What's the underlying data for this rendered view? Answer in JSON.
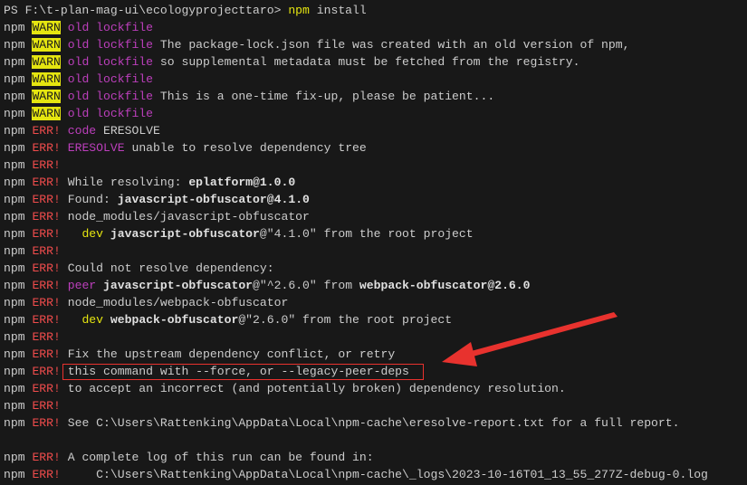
{
  "terminal": {
    "lines": [
      [
        [
          "t",
          "PS F:\\t-plan-mag-ui\\ecologyprojecttaro> "
        ],
        [
          "y",
          "npm"
        ],
        [
          "t",
          " install"
        ]
      ],
      [
        [
          "t",
          "npm "
        ],
        [
          "w",
          "WARN"
        ],
        [
          "t",
          " "
        ],
        [
          "m",
          "old lockfile"
        ]
      ],
      [
        [
          "t",
          "npm "
        ],
        [
          "w",
          "WARN"
        ],
        [
          "t",
          " "
        ],
        [
          "m",
          "old lockfile"
        ],
        [
          "t",
          " The package-lock.json file was created with an old version of npm,"
        ]
      ],
      [
        [
          "t",
          "npm "
        ],
        [
          "w",
          "WARN"
        ],
        [
          "t",
          " "
        ],
        [
          "m",
          "old lockfile"
        ],
        [
          "t",
          " so supplemental metadata must be fetched from the registry."
        ]
      ],
      [
        [
          "t",
          "npm "
        ],
        [
          "w",
          "WARN"
        ],
        [
          "t",
          " "
        ],
        [
          "m",
          "old lockfile"
        ]
      ],
      [
        [
          "t",
          "npm "
        ],
        [
          "w",
          "WARN"
        ],
        [
          "t",
          " "
        ],
        [
          "m",
          "old lockfile"
        ],
        [
          "t",
          " This is a one-time fix-up, please be patient..."
        ]
      ],
      [
        [
          "t",
          "npm "
        ],
        [
          "w",
          "WARN"
        ],
        [
          "t",
          " "
        ],
        [
          "m",
          "old lockfile"
        ]
      ],
      [
        [
          "t",
          "npm "
        ],
        [
          "r",
          "ERR!"
        ],
        [
          "t",
          " "
        ],
        [
          "m",
          "code"
        ],
        [
          "t",
          " ERESOLVE"
        ]
      ],
      [
        [
          "t",
          "npm "
        ],
        [
          "r",
          "ERR!"
        ],
        [
          "t",
          " "
        ],
        [
          "m",
          "ERESOLVE"
        ],
        [
          "t",
          " unable to resolve dependency tree"
        ]
      ],
      [
        [
          "t",
          "npm "
        ],
        [
          "r",
          "ERR!"
        ]
      ],
      [
        [
          "t",
          "npm "
        ],
        [
          "r",
          "ERR!"
        ],
        [
          "t",
          " While resolving: "
        ],
        [
          "b",
          "eplatform@1.0.0"
        ]
      ],
      [
        [
          "t",
          "npm "
        ],
        [
          "r",
          "ERR!"
        ],
        [
          "t",
          " Found: "
        ],
        [
          "b",
          "javascript-obfuscator@4.1.0"
        ]
      ],
      [
        [
          "t",
          "npm "
        ],
        [
          "r",
          "ERR!"
        ],
        [
          "t",
          " node_modules/javascript-obfuscator"
        ]
      ],
      [
        [
          "t",
          "npm "
        ],
        [
          "r",
          "ERR!"
        ],
        [
          "t",
          "   "
        ],
        [
          "y",
          "dev"
        ],
        [
          "t",
          " "
        ],
        [
          "b",
          "javascript-obfuscator"
        ],
        [
          "t",
          "@\"4.1.0\" from the root project"
        ]
      ],
      [
        [
          "t",
          "npm "
        ],
        [
          "r",
          "ERR!"
        ]
      ],
      [
        [
          "t",
          "npm "
        ],
        [
          "r",
          "ERR!"
        ],
        [
          "t",
          " Could not resolve dependency:"
        ]
      ],
      [
        [
          "t",
          "npm "
        ],
        [
          "r",
          "ERR!"
        ],
        [
          "t",
          " "
        ],
        [
          "m",
          "peer"
        ],
        [
          "t",
          " "
        ],
        [
          "b",
          "javascript-obfuscator"
        ],
        [
          "t",
          "@\"^2.6.0\" from "
        ],
        [
          "b",
          "webpack-obfuscator@2.6.0"
        ]
      ],
      [
        [
          "t",
          "npm "
        ],
        [
          "r",
          "ERR!"
        ],
        [
          "t",
          " node_modules/webpack-obfuscator"
        ]
      ],
      [
        [
          "t",
          "npm "
        ],
        [
          "r",
          "ERR!"
        ],
        [
          "t",
          "   "
        ],
        [
          "y",
          "dev"
        ],
        [
          "t",
          " "
        ],
        [
          "b",
          "webpack-obfuscator"
        ],
        [
          "t",
          "@\"2.6.0\" from the root project"
        ]
      ],
      [
        [
          "t",
          "npm "
        ],
        [
          "r",
          "ERR!"
        ]
      ],
      [
        [
          "t",
          "npm "
        ],
        [
          "r",
          "ERR!"
        ],
        [
          "t",
          " Fix the upstream dependency conflict, or retry"
        ]
      ],
      [
        [
          "t",
          "npm "
        ],
        [
          "r",
          "ERR!"
        ],
        [
          "t",
          " this command with --force, or --legacy-peer-deps"
        ]
      ],
      [
        [
          "t",
          "npm "
        ],
        [
          "r",
          "ERR!"
        ],
        [
          "t",
          " to accept an incorrect (and potentially broken) dependency resolution."
        ]
      ],
      [
        [
          "t",
          "npm "
        ],
        [
          "r",
          "ERR!"
        ]
      ],
      [
        [
          "t",
          "npm "
        ],
        [
          "r",
          "ERR!"
        ],
        [
          "t",
          " See C:\\Users\\Rattenking\\AppData\\Local\\npm-cache\\eresolve-report.txt for a full report."
        ]
      ],
      [],
      [
        [
          "t",
          "npm "
        ],
        [
          "r",
          "ERR!"
        ],
        [
          "t",
          " A complete log of this run can be found in:"
        ]
      ],
      [
        [
          "t",
          "npm "
        ],
        [
          "r",
          "ERR!"
        ],
        [
          "t",
          "     C:\\Users\\Rattenking\\AppData\\Local\\npm-cache\\_logs\\2023-10-16T01_13_55_277Z-debug-0.log"
        ]
      ]
    ]
  },
  "annotation": {
    "color": "#e8322e",
    "highlight": "red-box",
    "pointer": "red-arrow"
  }
}
